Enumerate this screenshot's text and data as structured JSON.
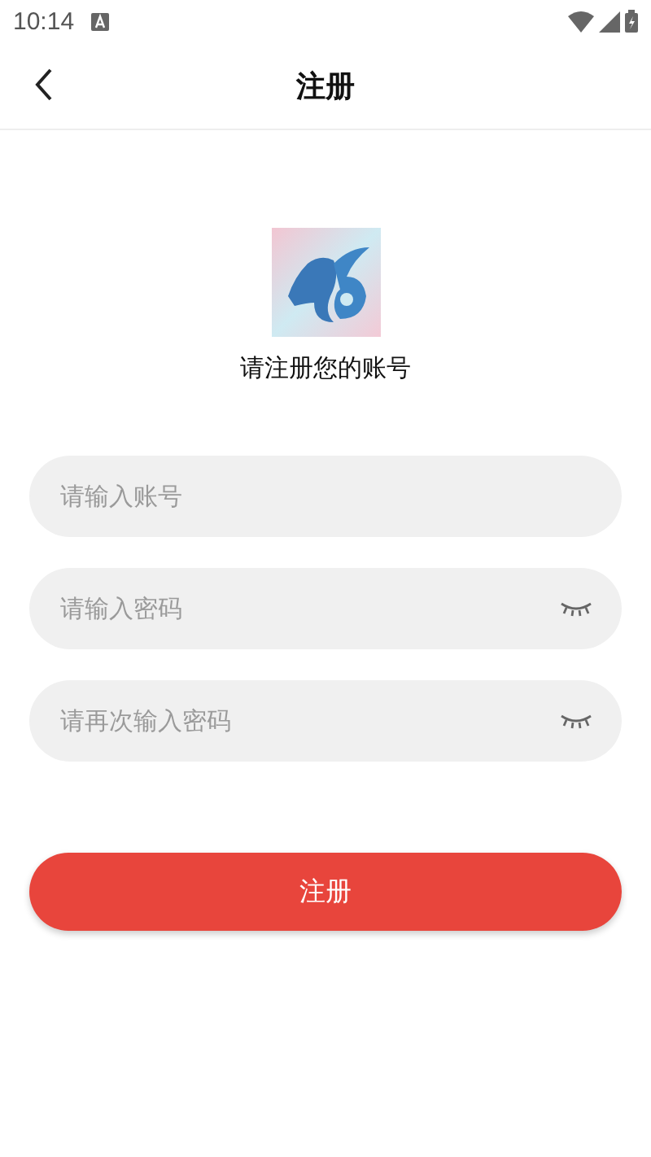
{
  "status_bar": {
    "time": "10:14"
  },
  "header": {
    "title": "注册"
  },
  "subtitle": "请注册您的账号",
  "fields": [
    {
      "placeholder": "请输入账号",
      "kind": "text"
    },
    {
      "placeholder": "请输入密码",
      "kind": "password"
    },
    {
      "placeholder": "请再次输入密码",
      "kind": "password"
    }
  ],
  "submit": "注册"
}
